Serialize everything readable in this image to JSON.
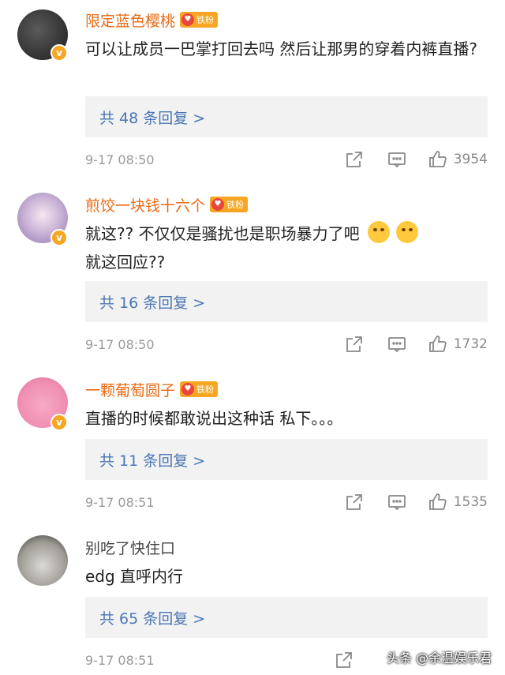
{
  "comments": [
    {
      "username": "限定蓝色樱桃",
      "fan_badge": "铁粉",
      "text": "可以让成员一巴掌打回去吗 然后让那男的穿着内裤直播?",
      "replies": "共 48 条回复 >",
      "time": "9-17 08:50",
      "likes": "3954"
    },
    {
      "username": "煎饺一块钱十六个",
      "fan_badge": "铁粉",
      "text_line1": "就这?? 不仅仅是骚扰也是职场暴力了吧",
      "text_line2": "就这回应??",
      "replies": "共 16 条回复 >",
      "time": "9-17 08:50",
      "likes": "1732"
    },
    {
      "username": "一颗葡萄圆子",
      "fan_badge": "铁粉",
      "text": "直播的时候都敢说出这种话 私下。。。",
      "replies": "共 11 条回复 >",
      "time": "9-17 08:51",
      "likes": "1535"
    },
    {
      "username": "别吃了快住口",
      "text": "edg 直呼内行",
      "replies": "共 65 条回复 >",
      "time": "9-17 08:51"
    }
  ],
  "watermark": "头条 @余温娱乐君",
  "colors": {
    "username": "#e86a15",
    "reply_link": "#4a76b5",
    "reply_bg": "#f2f2f2",
    "meta": "#999999",
    "vip_badge": "#f5a623"
  },
  "icons": [
    "v-badge",
    "heart-fan-icon",
    "share-icon",
    "comment-icon",
    "like-icon"
  ]
}
